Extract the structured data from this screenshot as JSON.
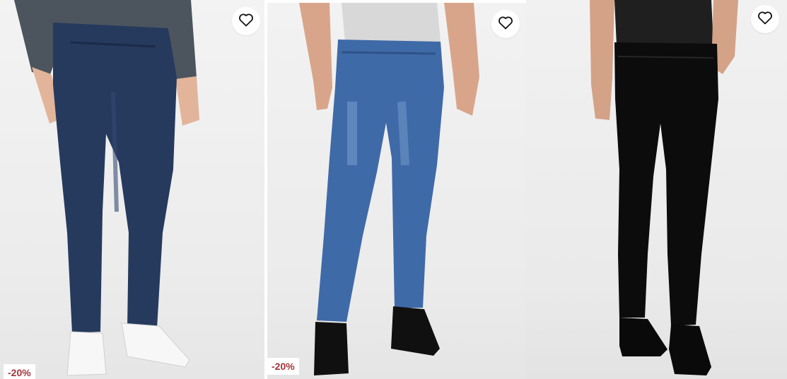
{
  "products": [
    {
      "discount": "-20%",
      "icons": {
        "favorite": "heart-outline-icon"
      },
      "colors": {
        "jeans": "#263a5e",
        "top": "#4a525c",
        "shoes": "#f4f4f4"
      }
    },
    {
      "discount": "-20%",
      "icons": {
        "favorite": "heart-outline-icon"
      },
      "colors": {
        "jeans": "#3f6aa8",
        "top": "#d9d9d9",
        "shoes": "#111111"
      }
    },
    {
      "discount": "",
      "icons": {
        "favorite": "heart-outline-icon"
      },
      "colors": {
        "jeans": "#0c0c0c",
        "top": "#1e1e1e",
        "shoes": "#0a0a0a"
      }
    }
  ],
  "colors": {
    "badge_text": "#a4343a",
    "badge_bg": "#ffffff"
  }
}
